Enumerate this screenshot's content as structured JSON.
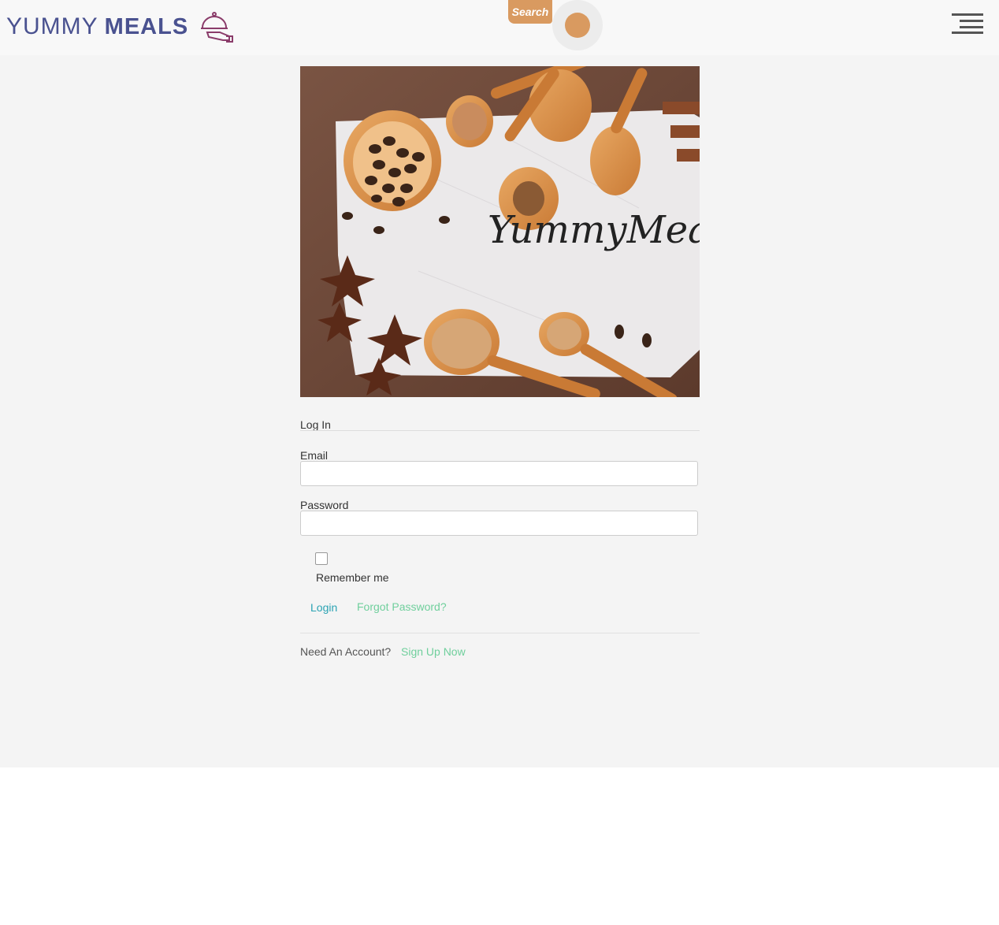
{
  "header": {
    "logo_word1": "YUMMY",
    "logo_word2": "MEALS",
    "logo_icon": "serving-cloche-icon",
    "search_label": "Search",
    "menu_icon": "hamburger-menu-icon"
  },
  "hero": {
    "title": "YummyMeals",
    "image": "spoons-spices-coffee-beans-photo"
  },
  "form": {
    "heading": "Log In",
    "email_label": "Email",
    "email_value": "",
    "password_label": "Password",
    "password_value": "",
    "remember_label": "Remember me",
    "remember_checked": false,
    "login_label": "Login",
    "forgot_label": "Forgot Password?",
    "need_account": "Need An Account?",
    "signup_label": "Sign Up Now"
  },
  "colors": {
    "brand": "#4a5290",
    "accent": "#d99a60",
    "link": "#2aa3b3",
    "link_secondary": "#6fcf9c",
    "page_bg": "#f4f4f4"
  }
}
